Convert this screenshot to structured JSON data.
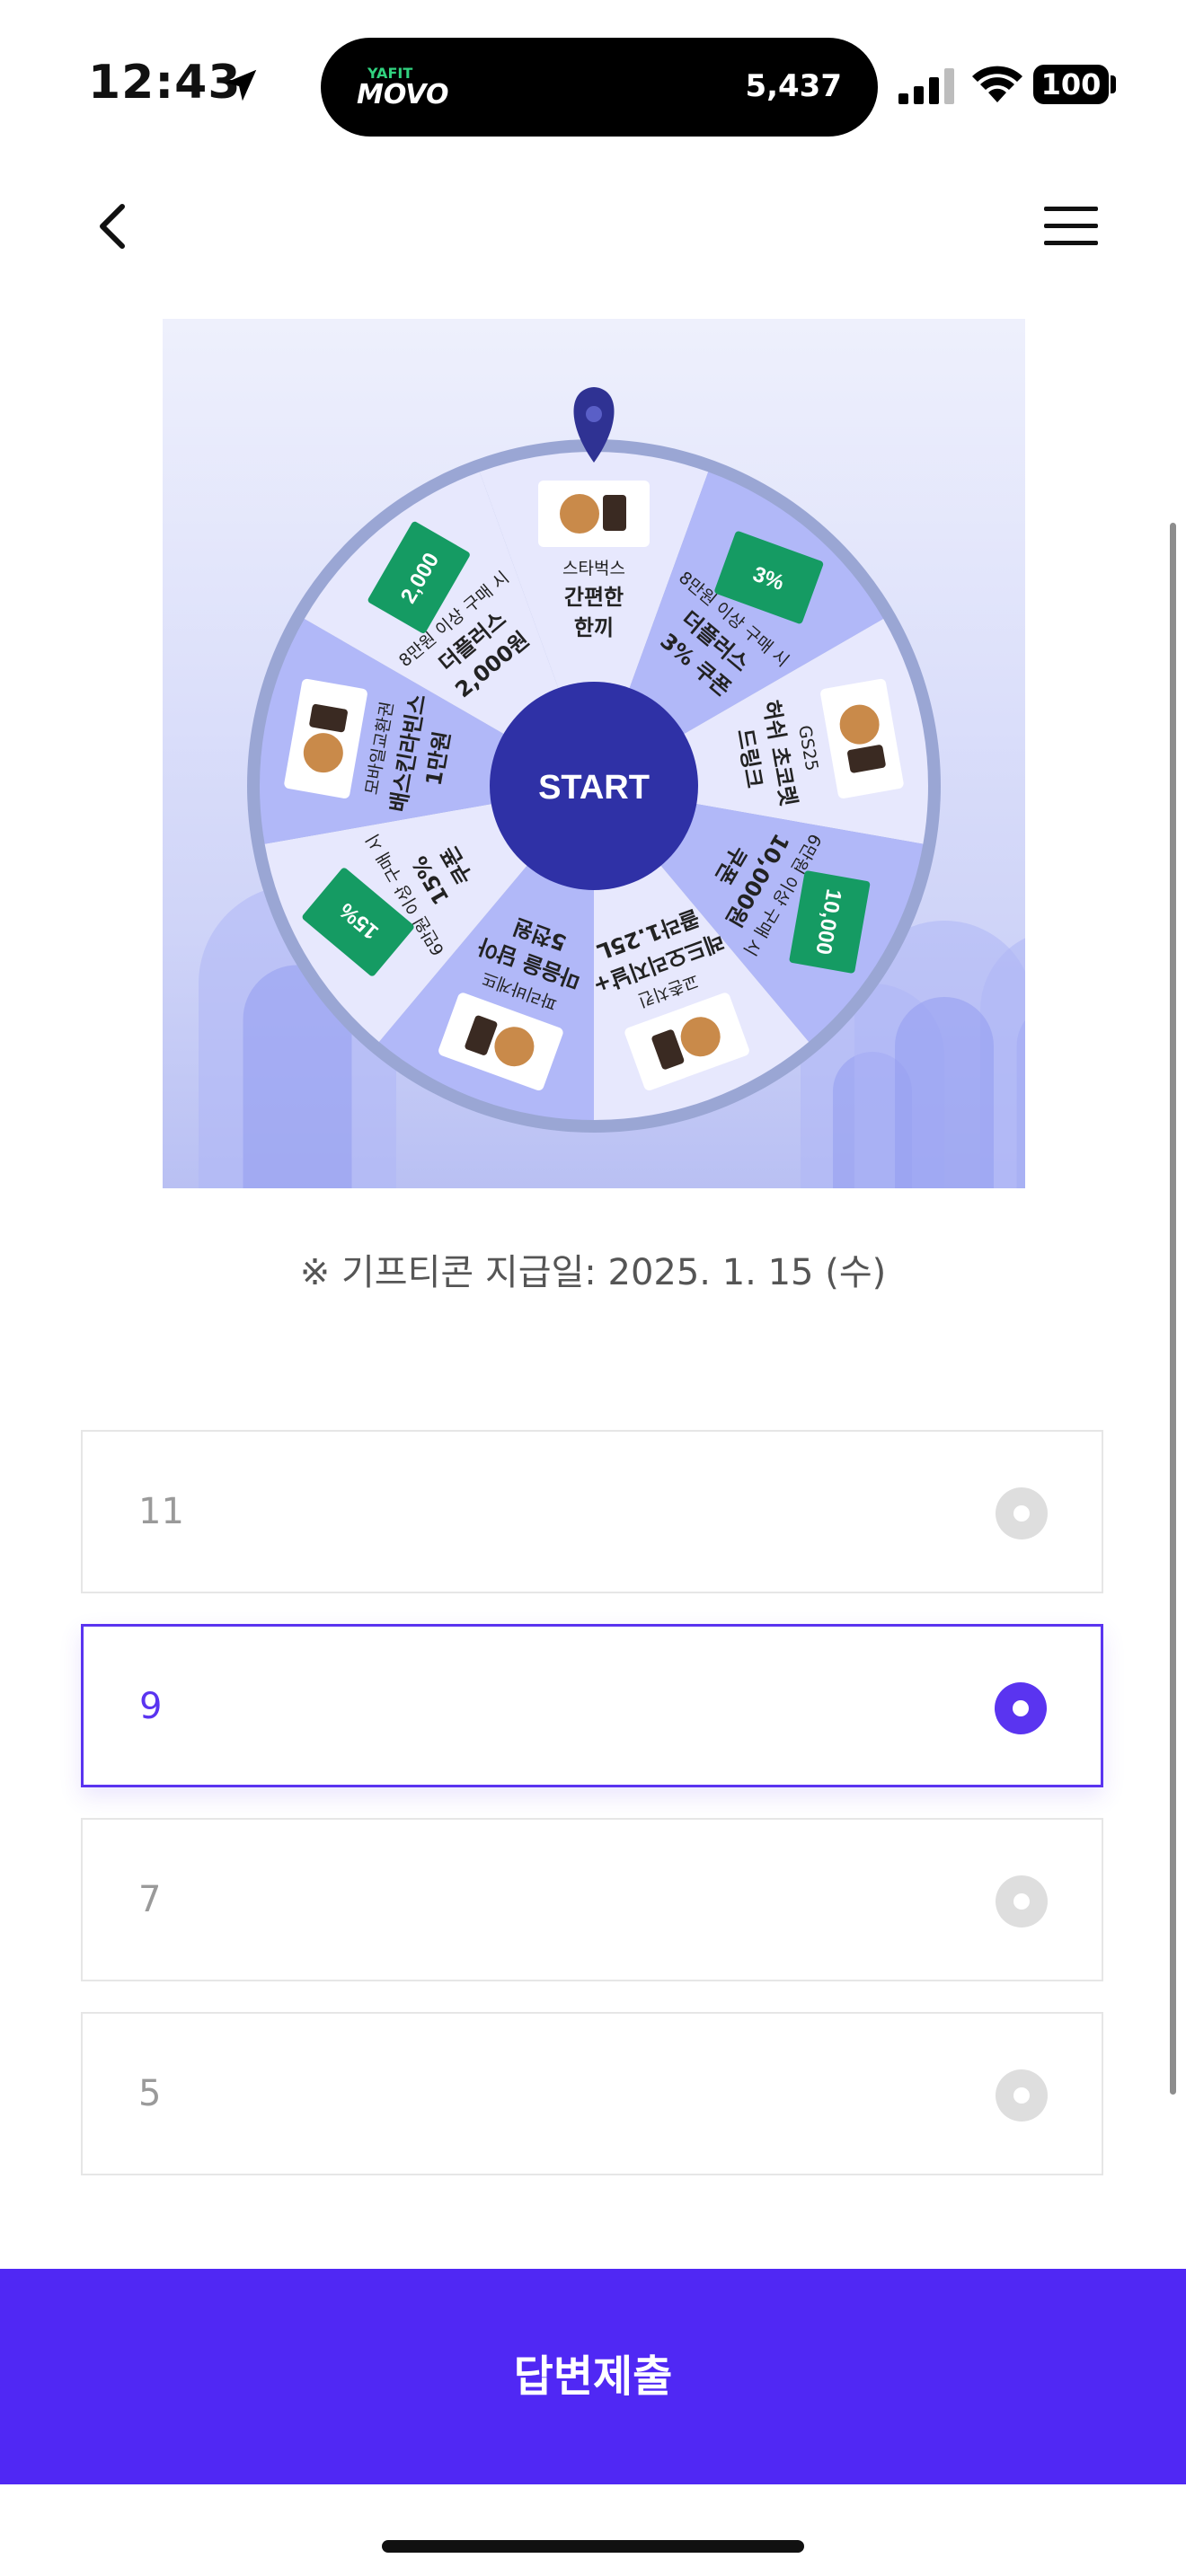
{
  "status_bar": {
    "time": "12:43",
    "island_brand_top": "YAFIT",
    "island_brand": "MOVO",
    "island_count": "5,437",
    "battery": "100"
  },
  "header": {
    "back_icon": "chevron-left-icon",
    "menu_icon": "hamburger-menu-icon"
  },
  "wheel": {
    "start_label": "START",
    "prizes": [
      {
        "lines": [
          "스타벅스",
          "간편한",
          "한끼"
        ]
      },
      {
        "lines": [
          "8만원 이상 구매 시",
          "더플러스",
          "3% 쿠폰"
        ],
        "coupon": "3%"
      },
      {
        "lines": [
          "GS25",
          "허쉬 초코렛",
          "드링크"
        ]
      },
      {
        "lines": [
          "6만원 이상 구매 시",
          "10,000원",
          "쿠폰"
        ],
        "coupon": "10,000"
      },
      {
        "lines": [
          "교촌치킨",
          "레드오리지날+",
          "콜라1.25L"
        ]
      },
      {
        "lines": [
          "파리바게뜨",
          "마음을 담아",
          "5천원"
        ]
      },
      {
        "lines": [
          "6만원 이상 구매 시",
          "15%",
          "쿠폰"
        ],
        "coupon": "15%"
      },
      {
        "lines": [
          "모바일교환권",
          "배스킨라빈스",
          "1만원"
        ]
      },
      {
        "lines": [
          "8만원 이상 구매 시",
          "더플러스",
          "2,000원"
        ],
        "coupon": "2,000"
      }
    ],
    "colors": {
      "light": "#e7e8fd",
      "mid": "#b1b8f8",
      "hub": "#2f31a6",
      "pointer": "#2f3293",
      "coupon": "#159b63"
    }
  },
  "notice": "※ 기프티콘 지급일: 2025. 1. 15 (수)",
  "options": [
    {
      "label": "11",
      "selected": false
    },
    {
      "label": "9",
      "selected": true
    },
    {
      "label": "7",
      "selected": false
    },
    {
      "label": "5",
      "selected": false
    }
  ],
  "submit_label": "답변제출",
  "accent_color": "#5028f4"
}
